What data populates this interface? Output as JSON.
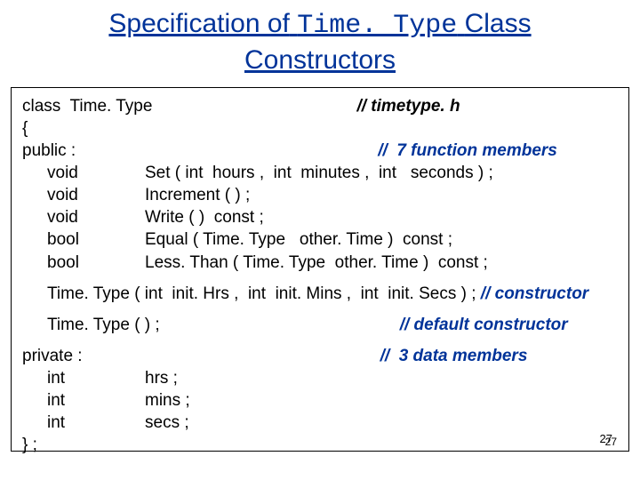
{
  "title": {
    "part1": "Specification of",
    "mono": "Time. Type",
    "part2": "Class",
    "part3": "Constructors"
  },
  "code": {
    "line_class": "class  Time. Type",
    "comment_header": "// timetype. h",
    "brace_open": "{",
    "public": "public :",
    "comment_public": "//  7 function members",
    "m_set_type": "void",
    "m_set_sig": "Set ( int  hours ,  int  minutes ,  int   seconds ) ;",
    "m_inc_type": "void",
    "m_inc_sig": "Increment ( ) ;",
    "m_write_type": "void",
    "m_write_sig": "Write ( )  const ;",
    "m_equal_type": "bool",
    "m_equal_sig": "Equal ( Time. Type   other. Time )  const ;",
    "m_less_type": "bool",
    "m_less_sig": "Less. Than ( Time. Type  other. Time )  const ;",
    "ctor1": "Time. Type ( int  init. Hrs ,  int  init. Mins ,  int  init. Secs ) ;",
    "ctor1_comment": "// constructor",
    "ctor2": "Time. Type ( ) ;",
    "ctor2_comment": "// default constructor",
    "private": "private :",
    "comment_private": "//  3 data members",
    "d_hrs_type": "int",
    "d_hrs": "hrs ;",
    "d_mins_type": "int",
    "d_mins": "mins ;",
    "d_secs_type": "int",
    "d_secs": "secs ;",
    "brace_close": "} ;"
  },
  "pagenum": "27",
  "pagenum2": "27"
}
